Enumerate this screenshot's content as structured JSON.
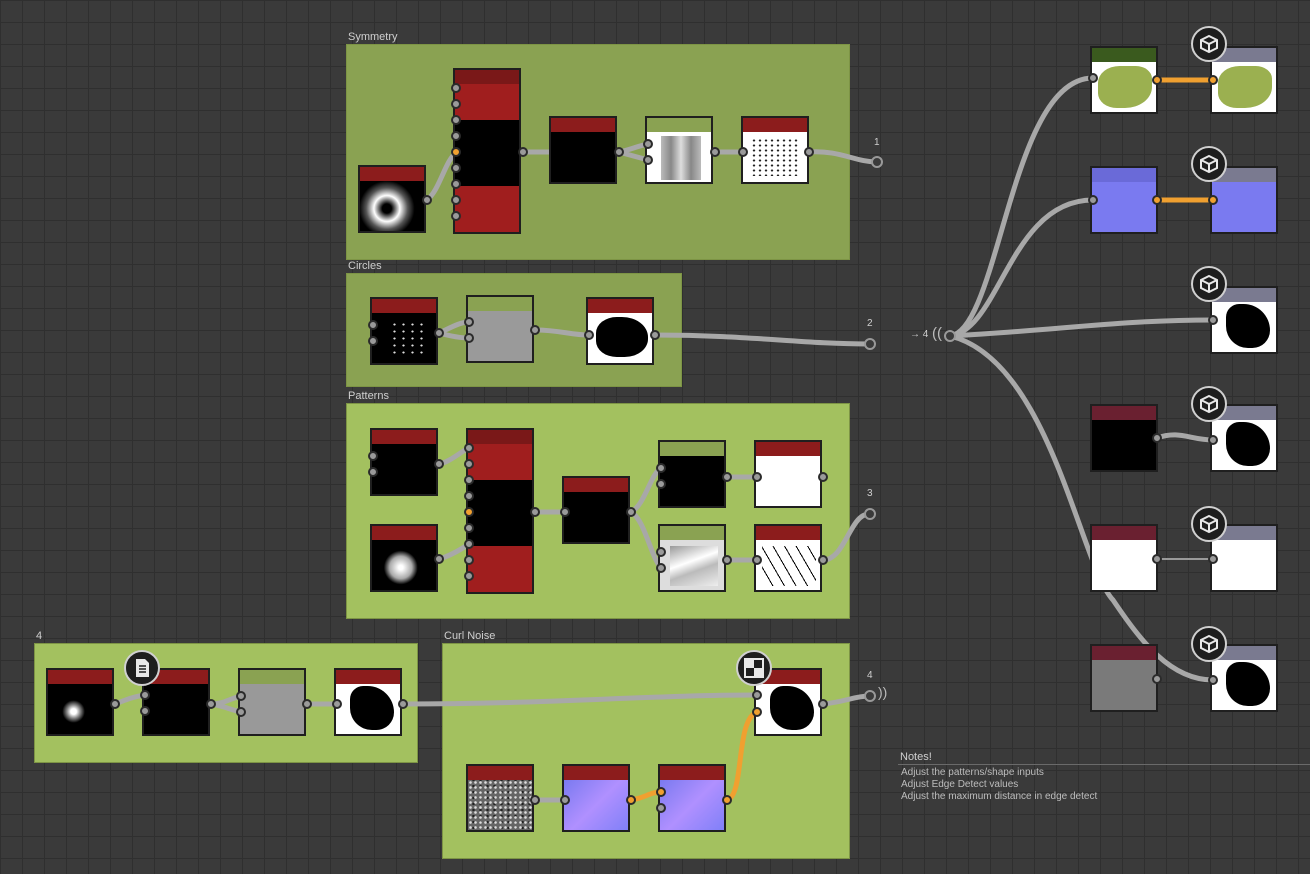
{
  "frames": {
    "symmetry": {
      "label": "Symmetry"
    },
    "circles": {
      "label": "Circles"
    },
    "patterns": {
      "label": "Patterns"
    },
    "four": {
      "label": "4"
    },
    "curl_noise": {
      "label": "Curl Noise"
    }
  },
  "outputs": {
    "out1": "1",
    "out2": "2",
    "out3": "3",
    "out4": "4",
    "hub": "→ 4"
  },
  "notes": {
    "title": "Notes!",
    "lines": [
      "Adjust the patterns/shape inputs",
      "Adjust Edge Detect values",
      "Adjust the maximum distance in edge detect"
    ]
  },
  "icons": {
    "material_badge": "cube-icon",
    "document_badge": "document-icon",
    "checker_badge": "checker-icon"
  },
  "colors": {
    "frame_green": "#a3c15f",
    "frame_green_dark": "#8aa252",
    "node_header_red": "#8c1c1c",
    "wire_orange": "#f0a030",
    "wire_gray": "#a8a8a8"
  }
}
